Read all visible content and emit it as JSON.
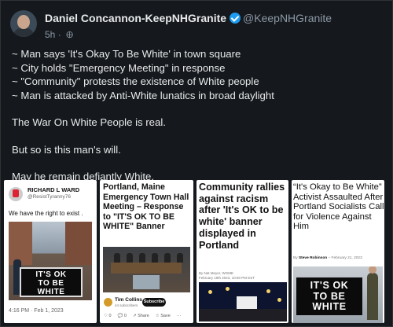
{
  "tweet": {
    "author_name": "Daniel Concannon-KeepNHGranite",
    "handle": "@KeepNHGranite",
    "time": "5h",
    "separator": "·",
    "verified_color": "#1d9bf0",
    "lines": [
      "~ Man says 'It's Okay To Be White' in town square",
      "~ City holds \"Emergency Meeting\" in response",
      "~ \"Community\" protests the existence of White people",
      "~ Man is attacked by Anti-White lunatics in broad daylight"
    ],
    "para2": "The War On White People is real.",
    "para3": "But so is this man's will.",
    "para4": "May he remain defiantly White."
  },
  "media": {
    "tile1": {
      "name": "RICHARD L WARD",
      "handle": "@ResistTyranny76",
      "text": "We have the right to exist .",
      "banner": [
        "IT'S OK",
        "TO BE",
        "WHITE"
      ],
      "date": "4:16 PM · Feb 1, 2023"
    },
    "tile2": {
      "headline": "Portland, Maine Emergency Town Hall Meeting – Response to \"IT'S OK TO BE WHITE\" Banner",
      "author": "Tim Collins",
      "author_sub": "44 subscribers",
      "subscribe": "Subscribe",
      "actions": [
        "♡ 0",
        "💬 0",
        "↗ Share",
        "☆ Save",
        "···"
      ]
    },
    "tile3": {
      "headline": "Community rallies against racism after 'It's OK to be white' banner displayed in Portland",
      "byline": "By Nat Meyer, WGME",
      "date": "February 19th 2023, 10:50 PM EST"
    },
    "tile4": {
      "headline": "“It's Okay to Be White” Activist Assaulted After Portland Socialists Call for Violence Against Him",
      "byline_prefix": "By",
      "author": "Steve Robinson",
      "date": "– February 21, 2023",
      "banner": [
        "IT'S OK",
        "TO BE",
        "WHITE"
      ]
    }
  }
}
